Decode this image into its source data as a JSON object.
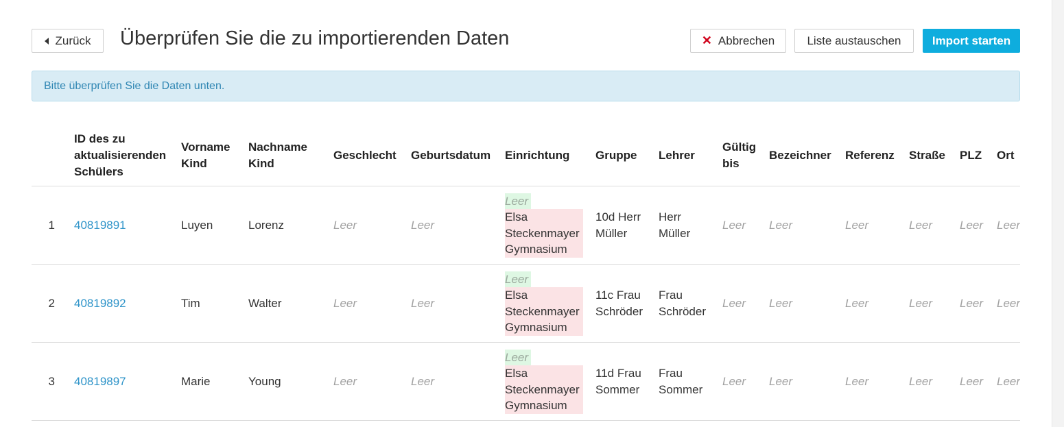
{
  "header": {
    "back_label": "Zurück",
    "title": "Überprüfen Sie die zu importierenden Daten",
    "cancel_label": "Abbrechen",
    "swap_label": "Liste austauschen",
    "import_label": "Import starten"
  },
  "banner": {
    "text": "Bitte überprüfen Sie die Daten unten."
  },
  "table": {
    "columns": [
      "ID des zu aktualisierenden Schülers",
      "Vorname Kind",
      "Nachname Kind",
      "Geschlecht",
      "Geburtsdatum",
      "Einrichtung",
      "Gruppe",
      "Lehrer",
      "Gültig bis",
      "Bezeichner",
      "Referenz",
      "Straße",
      "PLZ",
      "Ort"
    ],
    "empty_label": "Leer",
    "rows": [
      {
        "num": "1",
        "id": "40819891",
        "first": "Luyen",
        "last": "Lorenz",
        "inst_new": "Leer",
        "inst_old": "Elsa Steckenmayer Gymnasium",
        "group": "10d Herr Müller",
        "teacher": "Herr Müller"
      },
      {
        "num": "2",
        "id": "40819892",
        "first": "Tim",
        "last": "Walter",
        "inst_new": "Leer",
        "inst_old": "Elsa Steckenmayer Gymnasium",
        "group": "11c Frau Schröder",
        "teacher": "Frau Schröder"
      },
      {
        "num": "3",
        "id": "40819897",
        "first": "Marie",
        "last": "Young",
        "inst_new": "Leer",
        "inst_old": "Elsa Steckenmayer Gymnasium",
        "group": "11d Frau Sommer",
        "teacher": "Frau Sommer"
      }
    ]
  }
}
